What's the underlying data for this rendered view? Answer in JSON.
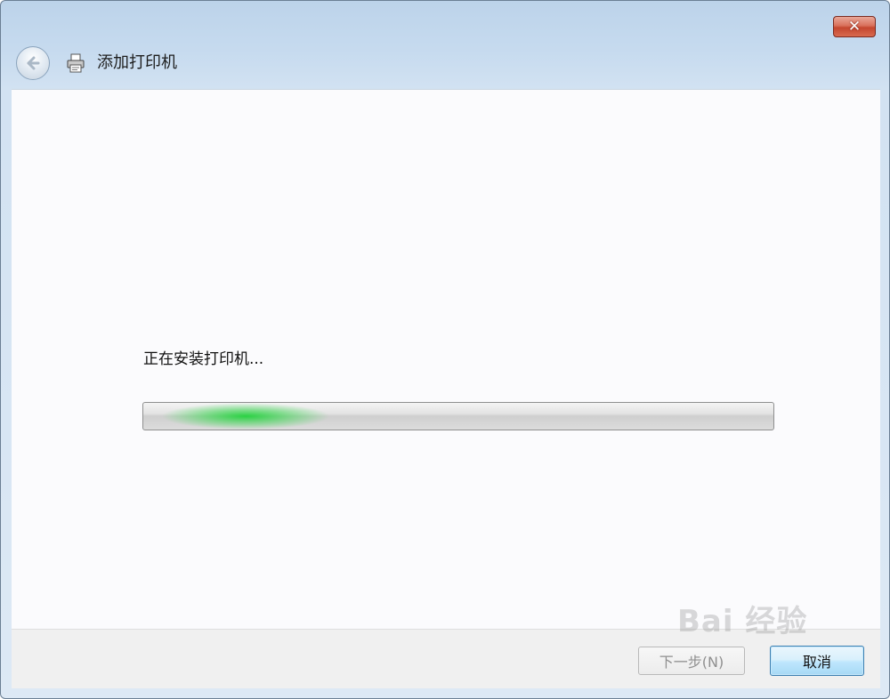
{
  "window": {
    "title": "添加打印机",
    "close_label": "✕"
  },
  "icons": {
    "back": "back-arrow-icon",
    "printer": "printer-icon",
    "close": "close-icon"
  },
  "content": {
    "status_text": "正在安装打印机...",
    "progress": "indeterminate"
  },
  "footer": {
    "next_label": "下一步(N)",
    "cancel_label": "取消"
  },
  "watermark": {
    "text": "Bai 经验"
  },
  "colors": {
    "progress_glow": "#22d23c",
    "close_button": "#c4462f",
    "default_button_border": "#3c7fb1"
  }
}
